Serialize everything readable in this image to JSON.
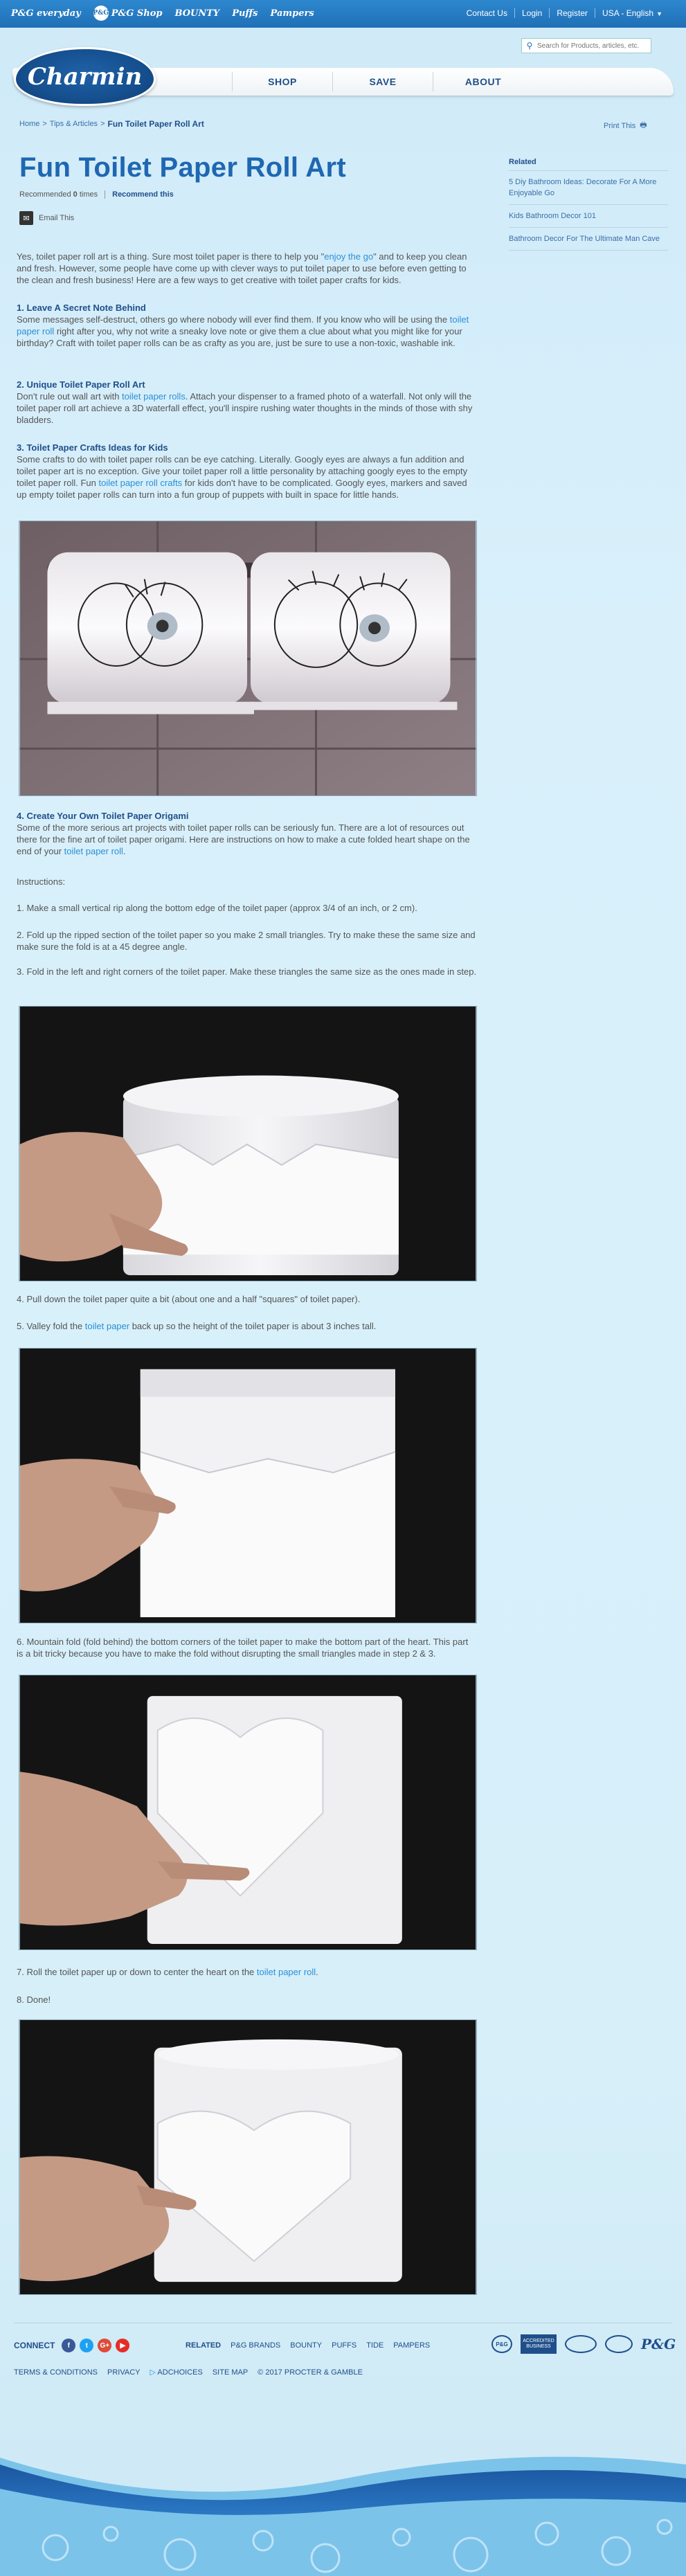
{
  "topbar": {
    "brands": [
      "P&G everyday",
      "P&G Shop",
      "BOUNTY",
      "Puffs",
      "Pampers"
    ],
    "links": [
      "Contact Us",
      "Login",
      "Register",
      "USA - English"
    ]
  },
  "header": {
    "logo": "Charmin",
    "search_placeholder": "Search for Products, articles, etc.",
    "nav": [
      "SHOP",
      "SAVE",
      "ABOUT"
    ]
  },
  "breadcrumb": {
    "items": [
      "Home",
      "Tips & Articles"
    ],
    "current": "Fun Toilet Paper Roll Art"
  },
  "print_label": "Print This",
  "article": {
    "title": "Fun Toilet Paper Roll Art",
    "recommended_prefix": "Recommended",
    "recommended_count": "0",
    "recommended_suffix": "times",
    "recommend_button": "Recommend this",
    "email_label": "Email This",
    "intro_1": "Yes, toilet paper roll art is a thing. Sure most toilet paper is there to help you \"",
    "intro_link": "enjoy the go",
    "intro_2": "\" and to keep you clean and fresh. However, some people have come up with clever ways to put toilet paper to use before even getting to the clean and fresh business!  Here are a few ways to get creative with toilet paper crafts for kids.",
    "s1_title": "1. Leave A Secret Note Behind",
    "s1_a": "Some messages self-destruct, others go where nobody will ever find them.  If you know who will be using the ",
    "s1_link": "toilet paper roll",
    "s1_b": " right after you, why not write a sneaky love note or give them a clue about what you might like for your birthday?  Craft with toilet paper rolls can be as crafty as you are, just be sure to use a non-toxic, washable ink.",
    "s2_title": "2. Unique Toilet Paper Roll Art",
    "s2_a": "Don't rule out wall art with ",
    "s2_link": "toilet paper rolls",
    "s2_b": ". Attach your dispenser to a framed photo of a waterfall.  Not only will the toilet paper roll art achieve a 3D waterfall effect, you'll inspire rushing water thoughts in the minds of those with shy bladders.",
    "s3_title": "3. Toilet Paper Crafts Ideas for Kids",
    "s3_a": "Some crafts to do with toilet paper rolls can be eye catching. Literally. Googly eyes are always a fun addition and toilet paper art is no exception.  Give your toilet paper roll a little personality by attaching googly eyes to the empty toilet paper roll.   Fun ",
    "s3_link": "toilet paper roll crafts",
    "s3_b": " for kids don't have to be complicated.  Googly eyes, markers and saved up empty toilet paper rolls can turn into a fun group of puppets with built in space for little hands.",
    "s4_title": "4. Create Your Own Toilet Paper Origami",
    "s4_a": "Some of the more serious art projects with toilet paper rolls can be seriously fun. There are a lot of resources out there for the fine art of toilet paper origami.  Here are instructions on how to make a cute folded heart shape on the end of your ",
    "s4_link": "toilet paper roll",
    "s4_b": ".",
    "instructions_label": "Instructions:",
    "step1": "1. Make a small vertical rip along the bottom edge of the toilet paper (approx 3/4 of an inch, or 2 cm).",
    "step2": "2. Fold up the ripped section of the toilet paper so you make 2 small triangles. Try to make these the same size and make sure the fold is at a 45 degree angle.",
    "step3": "3. Fold in the left and right corners of the toilet paper. Make these triangles the same size as the ones made in step.",
    "step4": "4. Pull down the toilet paper quite a bit (about one and a half \"squares\" of toilet paper).",
    "step5_a": "5. Valley fold the ",
    "step5_link": "toilet paper",
    "step5_b": " back up so the height of the toilet paper is about 3 inches tall.",
    "step6": "6. Mountain fold (fold behind) the bottom corners of the toilet paper to make the bottom part of the heart. This part is a bit tricky because you have to make the fold without disrupting the small triangles made in step 2 & 3.",
    "step7_a": "7. Roll the toilet paper up or down to center the heart on the ",
    "step7_link": "toilet paper roll",
    "step7_b": ".",
    "step8": "8. Done!"
  },
  "sidebar": {
    "title": "Related",
    "items": [
      "5 Diy Bathroom Ideas: Decorate For A More Enjoyable Go",
      "Kids Bathroom Decor 101",
      "Bathroom Decor For The Ultimate Man Cave"
    ]
  },
  "footer": {
    "connect_label": "CONNECT",
    "social": [
      "f",
      "t",
      "G+",
      "▶"
    ],
    "related_label": "RELATED",
    "related_brands": [
      "P&G BRANDS",
      "BOUNTY",
      "PUFFS",
      "TIDE",
      "PAMPERS"
    ],
    "legal": [
      "TERMS & CONDITIONS",
      "PRIVACY",
      "ADCHOICES",
      "SITE MAP"
    ],
    "copyright": "© 2017 PROCTER & GAMBLE",
    "bbb_text": "ACCREDITED BUSINESS",
    "pg_logo": "P&G"
  },
  "colors": {
    "topbar": "#2378c2",
    "title": "#1f67b1",
    "link": "#2b8fd6",
    "heading": "#1f4f8a"
  }
}
